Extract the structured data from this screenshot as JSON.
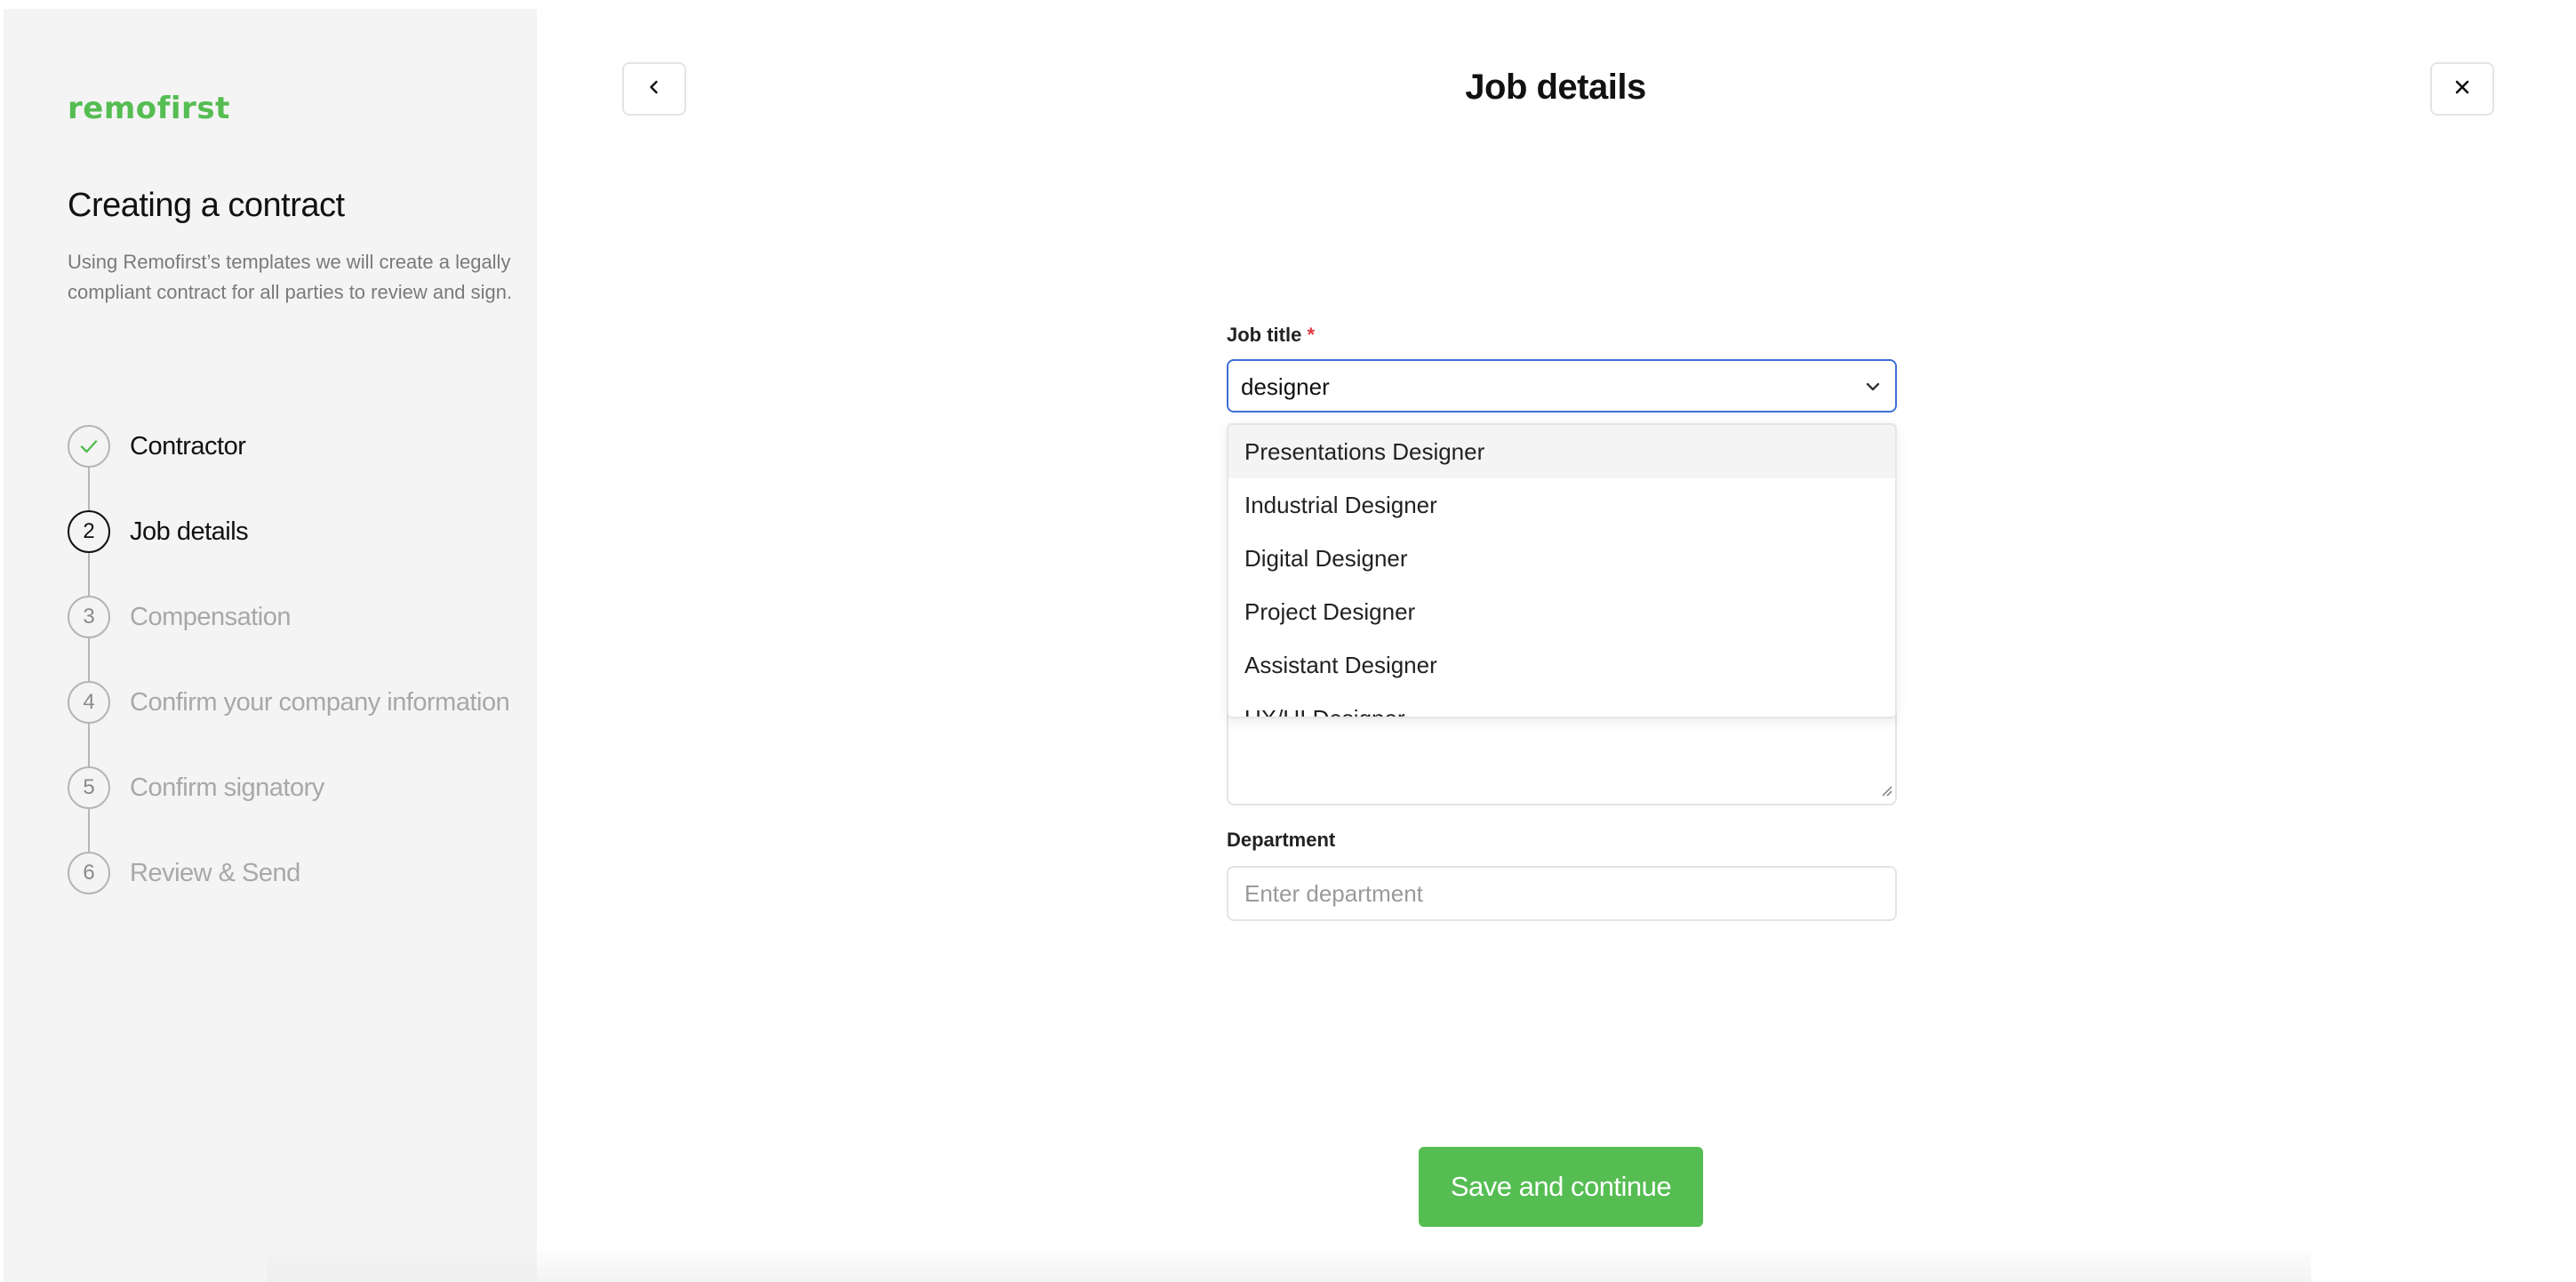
{
  "brand": {
    "logo": "remofirst",
    "accent": "#55bd52"
  },
  "sidebar": {
    "title": "Creating a contract",
    "description": "Using Remofirst’s templates we will create a legally compliant contract for all parties to review and sign.",
    "steps": [
      {
        "number": "1",
        "label": "Contractor",
        "state": "done"
      },
      {
        "number": "2",
        "label": "Job details",
        "state": "active"
      },
      {
        "number": "3",
        "label": "Compensation",
        "state": "pending"
      },
      {
        "number": "4",
        "label": "Confirm your company information",
        "state": "pending"
      },
      {
        "number": "5",
        "label": "Confirm signatory",
        "state": "pending"
      },
      {
        "number": "6",
        "label": "Review & Send",
        "state": "pending"
      }
    ]
  },
  "header": {
    "title": "Job details",
    "back_icon": "chevron-left-icon",
    "close_icon": "close-icon"
  },
  "form": {
    "job_title": {
      "label": "Job title",
      "required_mark": "*",
      "value": "designer",
      "options": [
        "Presentations Designer",
        "Industrial Designer",
        "Digital Designer",
        "Project Designer",
        "Assistant Designer",
        "UX/UI Designer"
      ],
      "highlighted_index": 0
    },
    "department": {
      "label": "Department",
      "placeholder": "Enter department"
    },
    "save_label": "Save and continue"
  }
}
